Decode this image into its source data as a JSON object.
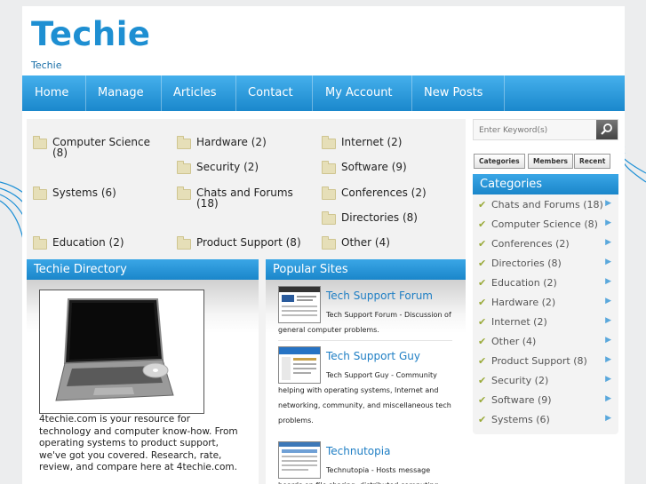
{
  "site": {
    "title": "Techie",
    "tagline": "Techie"
  },
  "nav": [
    "Home",
    "Manage",
    "Articles",
    "Contact",
    "My Account",
    "New Posts"
  ],
  "categories_grid": [
    "Computer Science (8)",
    "Hardware (2)",
    "Internet (2)",
    "Security (2)",
    "Software (9)",
    "Systems (6)",
    "Chats and Forums (18)",
    "Conferences (2)",
    "Directories (8)",
    "Education (2)",
    "Product Support (8)",
    "Other (4)"
  ],
  "directory": {
    "heading": "Techie Directory",
    "image": "laptop-computer",
    "text": "4techie.com is your resource for technology and computer know-how. From operating systems to product support, we've got you covered. Research, rate, review, and compare here at 4techie.com."
  },
  "popular": {
    "heading": "Popular Sites",
    "sites": [
      {
        "name": "Tech Support Forum",
        "desc": "Tech Support Forum - Discussion of general computer problems."
      },
      {
        "name": "Tech Support Guy",
        "desc": "Tech Support Guy - Community helping with operating systems, Internet and networking, community, and miscellaneous tech problems."
      },
      {
        "name": "Technutopia",
        "desc": "Technutopia - Hosts message boards on file sharing, distributed computing"
      }
    ]
  },
  "search": {
    "placeholder": "Enter Keyword(s)",
    "icon": "search-icon"
  },
  "tabs": [
    "Categories",
    "Members",
    "Recent"
  ],
  "sidebar": {
    "heading": "Categories",
    "items": [
      "Chats and Forums (18)",
      "Computer Science (8)",
      "Conferences (2)",
      "Directories (8)",
      "Education (2)",
      "Hardware (2)",
      "Internet (2)",
      "Other (4)",
      "Product Support (8)",
      "Security (2)",
      "Software (9)",
      "Systems (6)"
    ]
  },
  "colors": {
    "accent": "#1e8fd2",
    "nav": "#2c9ad9",
    "check": "#9aaa3a"
  }
}
